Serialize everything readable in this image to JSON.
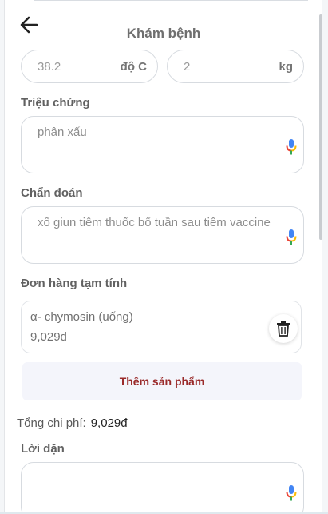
{
  "header": {
    "title": "Khám bệnh"
  },
  "vitals": {
    "temperature": {
      "value": "38.2",
      "unit": "độ C"
    },
    "weight": {
      "value": "2",
      "unit": "kg"
    }
  },
  "symptoms": {
    "label": "Triệu chứng",
    "value": "phân xấu"
  },
  "diagnosis": {
    "label": "Chẩn đoán",
    "value": "xổ giun tiêm thuốc bổ tuần sau tiêm vaccine"
  },
  "order": {
    "label": "Đơn hàng tạm tính",
    "items": [
      {
        "name": "α- chymosin (uống)",
        "price": "9,029đ"
      }
    ],
    "add_button": "Thêm sản phẩm"
  },
  "total": {
    "label": "Tổng chi phí:",
    "amount": "9,029đ"
  },
  "advice": {
    "label": "Lời dặn",
    "value": ""
  },
  "icons": {
    "back": "arrow-left-icon",
    "mic": "microphone-icon",
    "delete": "trash-icon"
  },
  "colors": {
    "add_button_text": "#9a2a2a",
    "mic_blue": "#4285f4",
    "mic_red": "#ea4335",
    "mic_yellow": "#fbbc05",
    "mic_green": "#34a853"
  }
}
